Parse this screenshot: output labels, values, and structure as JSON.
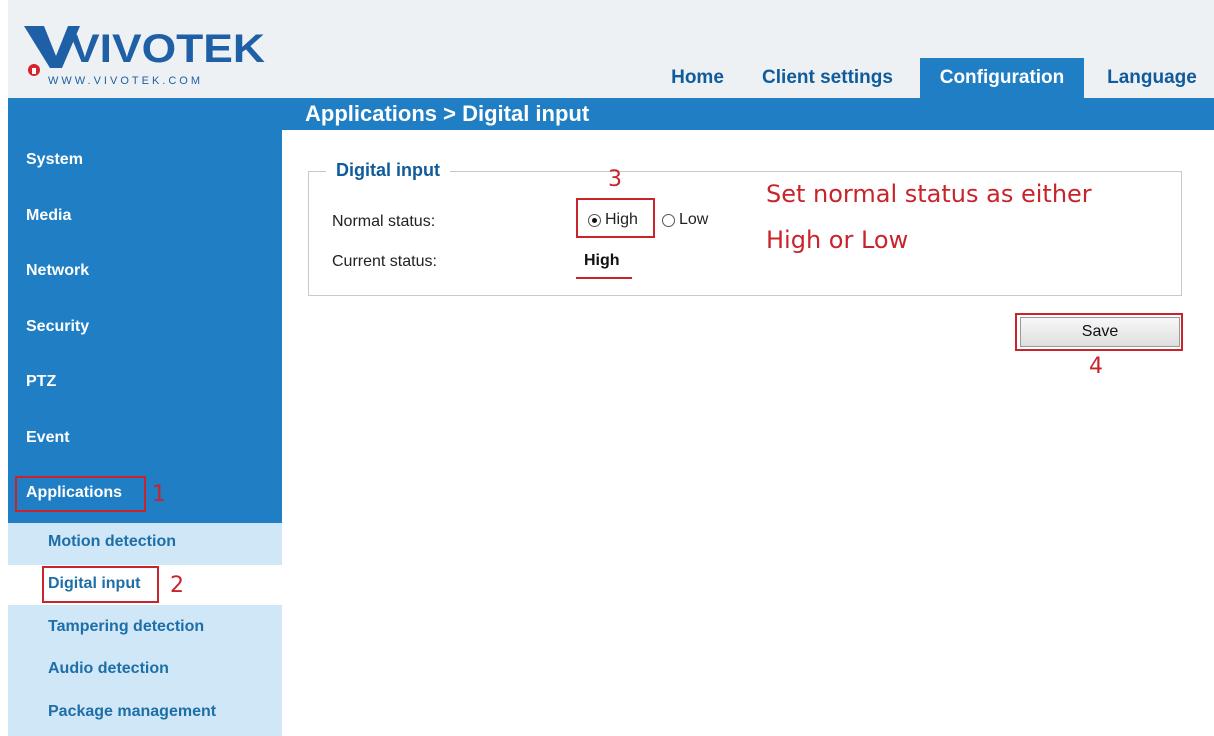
{
  "brand": {
    "logo_text": "VIVOTEK",
    "logo_url": "WWW.VIVOTEK.COM"
  },
  "nav": {
    "home": "Home",
    "client_settings": "Client settings",
    "configuration": "Configuration",
    "language": "Language"
  },
  "breadcrumb": "Applications > Digital input",
  "sidebar": {
    "items": [
      "System",
      "Media",
      "Network",
      "Security",
      "PTZ",
      "Event",
      "Applications"
    ],
    "subitems": [
      "Motion detection",
      "Digital input",
      "Tampering detection",
      "Audio detection",
      "Package management"
    ]
  },
  "panel": {
    "legend": "Digital input",
    "normal_status_label": "Normal status:",
    "option_high": "High",
    "option_low": "Low",
    "selected": "High",
    "current_status_label": "Current status:",
    "current_status_value": "High"
  },
  "save_label": "Save",
  "annotations": {
    "step1": "1",
    "step2": "2",
    "step3": "3",
    "step4": "4",
    "note_line1": "Set normal status as either",
    "note_line2": "High or Low"
  },
  "colors": {
    "accent_blue": "#1f7ec4",
    "annotation_red": "#c8242c",
    "submenu_bg": "#cfe7f6"
  }
}
